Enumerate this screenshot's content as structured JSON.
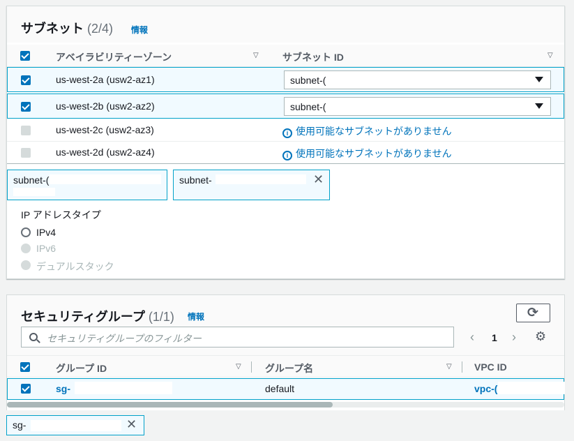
{
  "subnets": {
    "title": "サブネット",
    "count": "(2/4)",
    "info": "情報",
    "columns": [
      "アベイラビリティーゾーン",
      "サブネット ID"
    ],
    "rows": [
      {
        "az": "us-west-2a (usw2-az1)",
        "subnet": "subnet-(",
        "selected": true
      },
      {
        "az": "us-west-2b (usw2-az2)",
        "subnet": "subnet-(",
        "selected": true
      },
      {
        "az": "us-west-2c (usw2-az3)",
        "message": "使用可能なサブネットがありません",
        "selected": false
      },
      {
        "az": "us-west-2d (usw2-az4)",
        "message": "使用可能なサブネットがありません",
        "selected": false
      }
    ],
    "tokens": [
      "subnet-(",
      "subnet-"
    ],
    "ip_label": "IP アドレスタイプ",
    "ip_options": [
      {
        "label": "IPv4",
        "enabled": true
      },
      {
        "label": "IPv6",
        "enabled": false
      },
      {
        "label": "デュアルスタック",
        "enabled": false
      }
    ]
  },
  "security_groups": {
    "title": "セキュリティグループ",
    "count": "(1/1)",
    "info": "情報",
    "search_placeholder": "セキュリティグループのフィルター",
    "page": "1",
    "columns": [
      "グループ ID",
      "グループ名",
      "VPC ID"
    ],
    "rows": [
      {
        "group_id": "sg-",
        "group_name": "default",
        "vpc_id": "vpc-("
      }
    ],
    "token": "sg-"
  },
  "icons": {
    "info": "i",
    "close": "✕",
    "refresh": "⟳",
    "search": "search-icon",
    "settings": "⚙"
  },
  "colors": {
    "accent": "#0073bb",
    "selected_bg": "#f1faff",
    "selected_border": "#00a1c9"
  }
}
